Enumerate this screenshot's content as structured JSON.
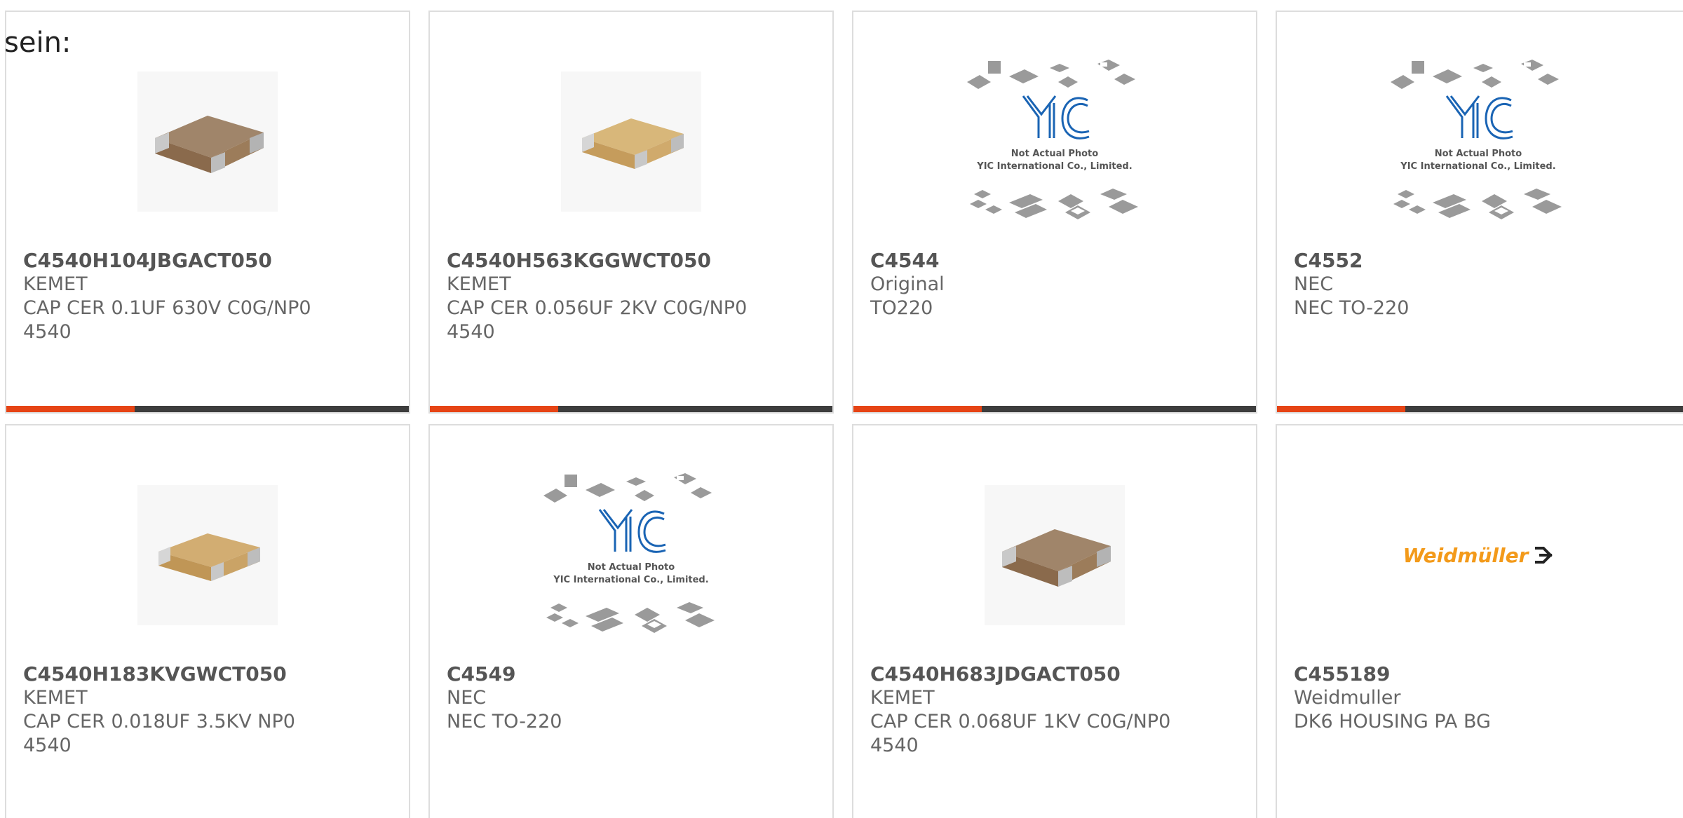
{
  "intro_text": "sein:",
  "colors": {
    "accent": "#e64415",
    "bar_dark": "#3d3d3d",
    "border": "#dddddd",
    "text": "#666666",
    "weidmuller_orange": "#f39a1a",
    "yic_blue": "#1a64b4"
  },
  "products": [
    {
      "part": "C4540H104JBGACT050",
      "manufacturer": "KEMET",
      "description": "CAP CER 0.1UF 630V C0G/NP0",
      "package": "4540",
      "image": "ceramic-capacitor-dark"
    },
    {
      "part": "C4540H563KGGWCT050",
      "manufacturer": "KEMET",
      "description": "CAP CER 0.056UF 2KV C0G/NP0",
      "package": "4540",
      "image": "ceramic-capacitor-light"
    },
    {
      "part": "C4544",
      "manufacturer": "Original",
      "description": "TO220",
      "package": "",
      "image": "yic-placeholder",
      "image_caption_1": "Not Actual Photo",
      "image_caption_2": "YIC International Co., Limited."
    },
    {
      "part": "C4552",
      "manufacturer": "NEC",
      "description": "NEC TO-220",
      "package": "",
      "image": "yic-placeholder",
      "image_caption_1": "Not Actual Photo",
      "image_caption_2": "YIC International Co., Limited."
    },
    {
      "part": "C4540H183KVGWCT050",
      "manufacturer": "KEMET",
      "description": "CAP CER 0.018UF 3.5KV NP0",
      "package": "4540",
      "image": "ceramic-capacitor-light"
    },
    {
      "part": "C4549",
      "manufacturer": "NEC",
      "description": "NEC TO-220",
      "package": "",
      "image": "yic-placeholder",
      "image_caption_1": "Not Actual Photo",
      "image_caption_2": "YIC International Co., Limited."
    },
    {
      "part": "C4540H683JDGACT050",
      "manufacturer": "KEMET",
      "description": "CAP CER 0.068UF 1KV C0G/NP0",
      "package": "4540",
      "image": "ceramic-capacitor-dark"
    },
    {
      "part": "C455189",
      "manufacturer": "Weidmuller",
      "description": "DK6 HOUSING PA BG",
      "package": "",
      "image": "weidmuller-logo",
      "logo_text": "Weidmüller"
    }
  ]
}
